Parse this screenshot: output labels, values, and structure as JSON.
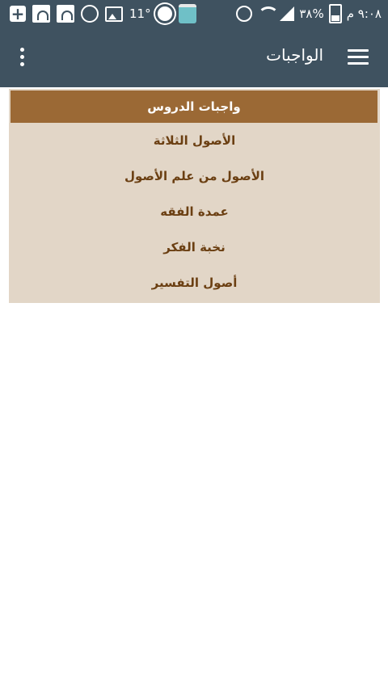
{
  "status_bar": {
    "temperature": "11°",
    "battery_percent": "٣٨%",
    "time": "٩:٠٨ م",
    "icons": [
      "plus-box-icon",
      "mosque-icon",
      "mosque-icon",
      "whatsapp-icon",
      "image-icon",
      "gear-icon",
      "store-icon",
      "alarm-icon",
      "wifi-icon",
      "signal-icon",
      "battery-icon"
    ]
  },
  "app_bar": {
    "title": "الواجبات",
    "menu_icon": "hamburger-menu-icon",
    "overflow_icon": "more-vertical-icon"
  },
  "menu": {
    "header": "واجبات الدروس",
    "items": [
      {
        "label": "الأصول الثلاثة"
      },
      {
        "label": "الأصول من علم الأصول"
      },
      {
        "label": "عمدة الفقه"
      },
      {
        "label": "نخبة الفكر"
      },
      {
        "label": "أصول التفسير"
      }
    ]
  },
  "colors": {
    "app_bar": "#3f5260",
    "panel_bg": "#e2d6c7",
    "header_bg": "#9b6935",
    "item_text": "#6b3f12"
  }
}
